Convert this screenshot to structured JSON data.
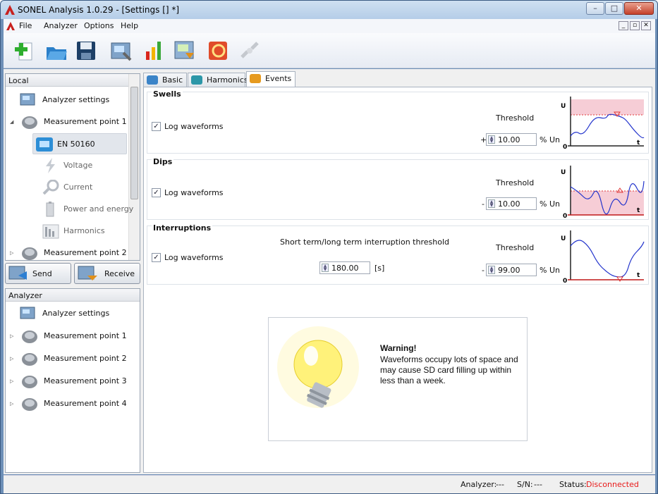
{
  "window": {
    "title": "SONEL Analysis 1.0.29 - [Settings [] *]",
    "minimize": "–",
    "maximize": "□",
    "close": "✕"
  },
  "menu": {
    "items": [
      "File",
      "Analyzer",
      "Options",
      "Help"
    ],
    "mdi": [
      "_",
      "▫",
      "✕"
    ]
  },
  "toolbar": {
    "icons": [
      "new-icon",
      "open-icon",
      "save-icon",
      "analyzer-settings-icon",
      "chart-icon",
      "read-data-icon",
      "sync-icon",
      "disconnect-icon"
    ]
  },
  "local": {
    "header": "Local",
    "items": [
      {
        "label": "Analyzer settings",
        "icon": "analyzer-settings-icon"
      },
      {
        "label": "Measurement point 1",
        "icon": "measurement-point-icon",
        "expander": "◢"
      },
      {
        "label": "EN 50160",
        "icon": "standard-icon"
      },
      {
        "label": "Voltage",
        "icon": "voltage-icon"
      },
      {
        "label": "Current",
        "icon": "current-clamp-icon"
      },
      {
        "label": "Power and energy",
        "icon": "power-icon"
      },
      {
        "label": "Harmonics",
        "icon": "harmonics-icon"
      },
      {
        "label": "Measurement point 2",
        "icon": "measurement-point-icon",
        "expander": "▷"
      }
    ]
  },
  "buttons": {
    "send": "Send",
    "receive": "Receive"
  },
  "analyzer": {
    "header": "Analyzer",
    "items": [
      {
        "label": "Analyzer settings"
      },
      {
        "label": "Measurement point 1",
        "expander": "▷"
      },
      {
        "label": "Measurement point 2",
        "expander": "▷"
      },
      {
        "label": "Measurement point 3",
        "expander": "▷"
      },
      {
        "label": "Measurement point 4",
        "expander": "▷"
      }
    ]
  },
  "tabs": [
    {
      "label": "Basic"
    },
    {
      "label": "Harmonics"
    },
    {
      "label": "Events"
    }
  ],
  "events": {
    "swells": {
      "title": "Swells",
      "log": "Log waveforms",
      "threshold_label": "Threshold",
      "sign": "+",
      "value": "10.00",
      "unit": "% Un"
    },
    "dips": {
      "title": "Dips",
      "log": "Log waveforms",
      "threshold_label": "Threshold",
      "sign": "-",
      "value": "10.00",
      "unit": "% Un"
    },
    "interruptions": {
      "title": "Interruptions",
      "log": "Log waveforms",
      "short_long_label": "Short term/long term interruption threshold",
      "time_value": "180.00",
      "time_unit": "[s]",
      "threshold_label": "Threshold",
      "sign": "-",
      "value": "99.00",
      "unit": "% Un"
    },
    "graph_labels": {
      "y": "U",
      "x": "t",
      "zero": "0"
    }
  },
  "warning": {
    "title": "Warning!",
    "text": "Waveforms occupy lots of space and may cause SD card filling up within less than a week."
  },
  "status": {
    "analyzer_label": "Analyzer:",
    "analyzer_value": "---",
    "sn_label": "S/N:",
    "sn_value": "---",
    "status_label": "Status:",
    "status_value": "Disconnected"
  }
}
